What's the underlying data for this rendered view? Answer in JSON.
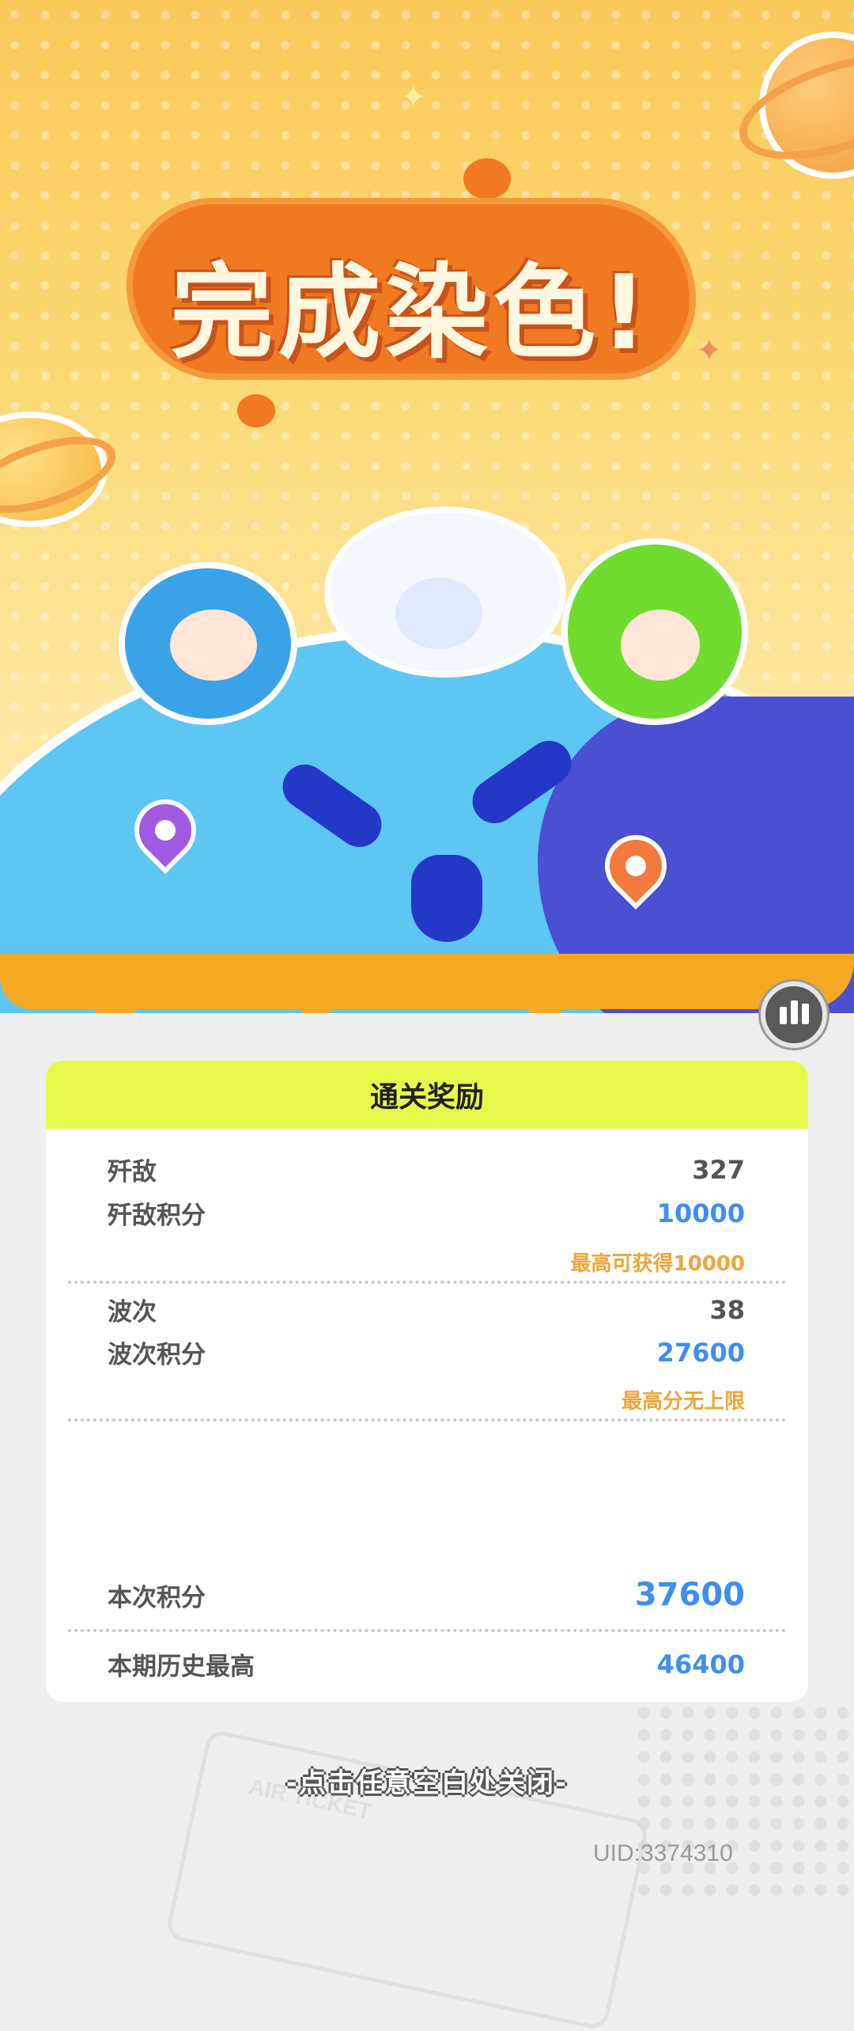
{
  "title": "完成染色!",
  "card": {
    "header": "通关奖励",
    "rows": [
      {
        "label": "歼敌",
        "value": "327"
      },
      {
        "label": "歼敌积分",
        "value": "10000"
      },
      {
        "note": "最高可获得10000"
      },
      {
        "label": "波次",
        "value": "38"
      },
      {
        "label": "波次积分",
        "value": "27600"
      },
      {
        "note": "最高分无上限"
      },
      {
        "label": "本次积分",
        "value": "37600"
      },
      {
        "label": "本期历史最高",
        "value": "46400"
      }
    ]
  },
  "close_hint": "-点击任意空白处关闭-",
  "uid": "UID:3374310",
  "ticket_text": "AIR TICKET",
  "colors": {
    "header": "#e6f84c",
    "blue_value": "#3d8ef0",
    "note": "#eea53a",
    "title_blob": "#f07a22"
  },
  "icons": [
    "stats-icon",
    "location-pin-icon",
    "planet-icon",
    "sparkle-icon"
  ]
}
